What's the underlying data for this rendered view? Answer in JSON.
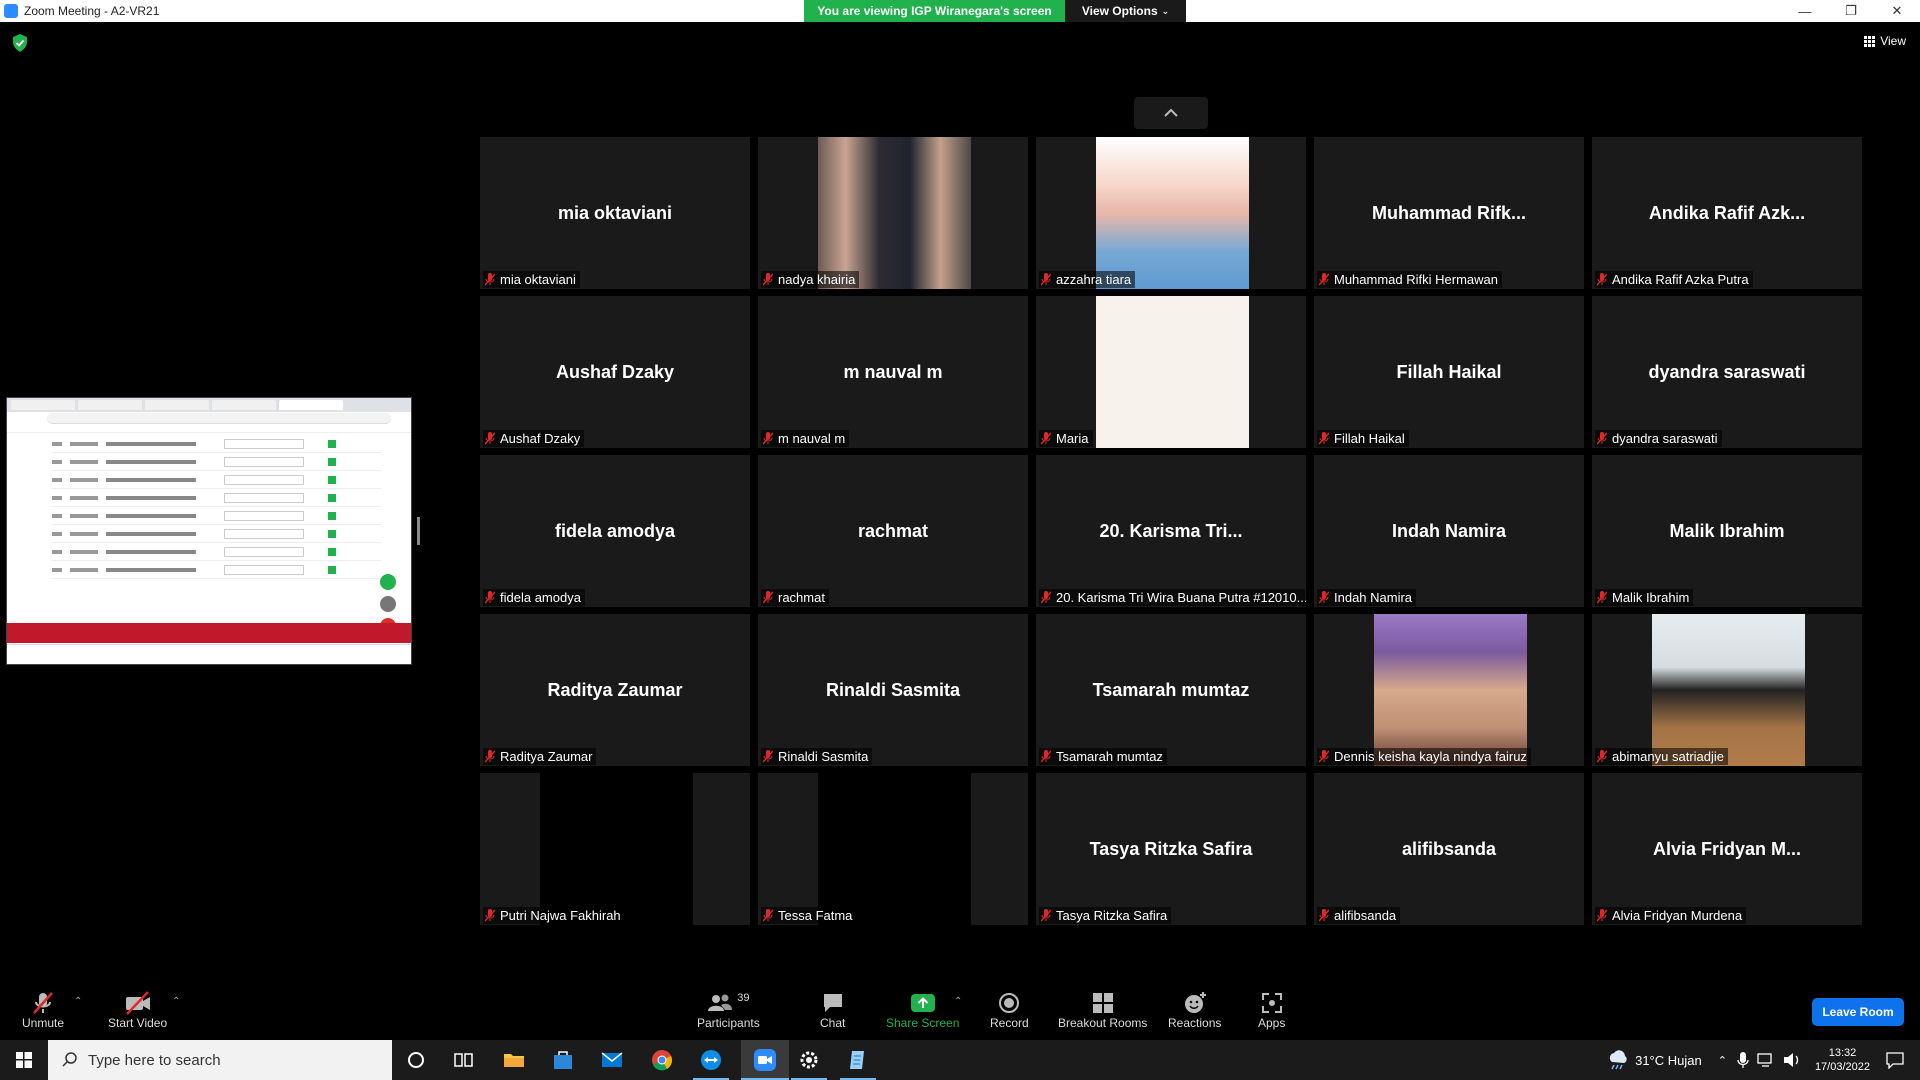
{
  "window": {
    "title": "Zoom Meeting - A2-VR21"
  },
  "banner": {
    "viewing": "You are viewing IGP Wiranegara's screen",
    "view_options": "View Options"
  },
  "top_right": {
    "view_label": "View"
  },
  "colors": {
    "accent_green": "#21b24d",
    "tile_bg": "#1a1a1a",
    "leave_blue": "#0e72ed",
    "mic_off_red": "#e02828"
  },
  "tiles": [
    {
      "big": "mia oktaviani",
      "label": "mia oktaviani"
    },
    {
      "big": "",
      "label": "nadya khairia",
      "photo": "woman-selfie-photo"
    },
    {
      "big": "",
      "label": "azzahra tiara",
      "photo": "woman-sunglasses-photo"
    },
    {
      "big": "Muhammad  Rifk...",
      "label": "Muhammad Rifki Hermawan"
    },
    {
      "big": "Andika Rafif Azk...",
      "label": "Andika Rafif Azka Putra"
    },
    {
      "big": "Aushaf Dzaky",
      "label": "Aushaf Dzaky"
    },
    {
      "big": "m nauval m",
      "label": "m nauval m"
    },
    {
      "big": "",
      "label": "Maria",
      "photo": "blank-wall-photo"
    },
    {
      "big": "Fillah Haikal",
      "label": "Fillah Haikal"
    },
    {
      "big": "dyandra saraswati",
      "label": "dyandra saraswati"
    },
    {
      "big": "fidela amodya",
      "label": "fidela amodya"
    },
    {
      "big": "rachmat",
      "label": "rachmat"
    },
    {
      "big": "20. Karisma Tri...",
      "label": "20. Karisma Tri Wira Buana Putra #12010..."
    },
    {
      "big": "Indah Namira",
      "label": "Indah Namira"
    },
    {
      "big": "Malik Ibrahim",
      "label": "Malik Ibrahim"
    },
    {
      "big": "Raditya Zaumar",
      "label": "Raditya Zaumar"
    },
    {
      "big": "Rinaldi Sasmita",
      "label": "Rinaldi Sasmita"
    },
    {
      "big": "Tsamarah mumtaz",
      "label": "Tsamarah mumtaz"
    },
    {
      "big": "",
      "label": "Dennis keisha kayla nindya fairuz",
      "photo": "woman-portrait-photo"
    },
    {
      "big": "",
      "label": "abimanyu satriadjie",
      "photo": "man-mask-photo"
    },
    {
      "big": "",
      "label": "Putri Najwa Fakhirah",
      "photo": "dark-video"
    },
    {
      "big": "",
      "label": "Tessa Fatma",
      "photo": "dark-video"
    },
    {
      "big": "Tasya Ritzka Safira",
      "label": "Tasya Ritzka Safira"
    },
    {
      "big": "alifibsanda",
      "label": "alifibsanda"
    },
    {
      "big": "Alvia Fridyan M...",
      "label": "Alvia Fridyan Murdena"
    }
  ],
  "toolbar": {
    "unmute": "Unmute",
    "start_video": "Start Video",
    "participants": "Participants",
    "participants_count": "39",
    "chat": "Chat",
    "share_screen": "Share Screen",
    "record": "Record",
    "breakout_rooms": "Breakout Rooms",
    "reactions": "Reactions",
    "apps": "Apps",
    "leave": "Leave Room"
  },
  "taskbar": {
    "search_placeholder": "Type here to search",
    "weather": "31°C  Hujan",
    "time": "13:32",
    "date": "17/03/2022"
  }
}
